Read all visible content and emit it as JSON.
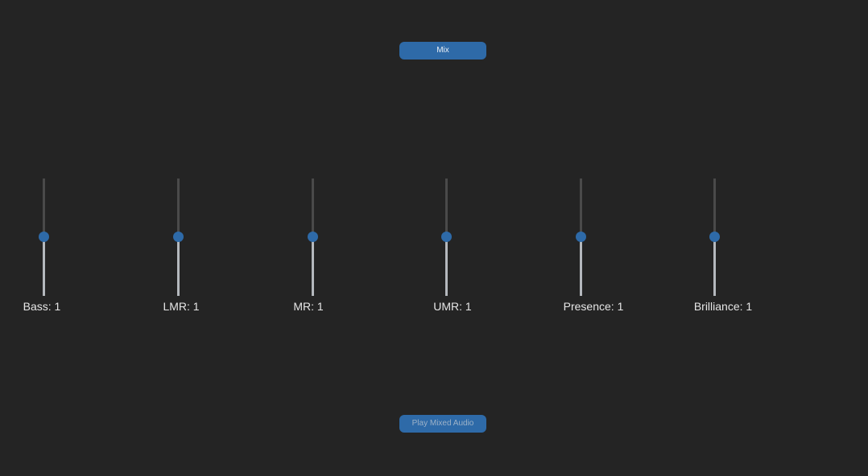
{
  "buttons": {
    "mix_label": "Mix",
    "play_label": "Play Mixed Audio"
  },
  "sliders": [
    {
      "name": "Bass",
      "value": 1,
      "label": "Bass: 1"
    },
    {
      "name": "LMR",
      "value": 1,
      "label": "LMR: 1"
    },
    {
      "name": "MR",
      "value": 1,
      "label": "MR: 1"
    },
    {
      "name": "UMR",
      "value": 1,
      "label": "UMR: 1"
    },
    {
      "name": "Presence",
      "value": 1,
      "label": "Presence: 1"
    },
    {
      "name": "Brilliance",
      "value": 1,
      "label": "Brilliance: 1"
    }
  ],
  "colors": {
    "background": "#242424",
    "accent": "#2e6aa8",
    "track_filled": "#b4b8bd",
    "track_empty": "#4a4a4a",
    "label_text": "#e6e6e6"
  }
}
